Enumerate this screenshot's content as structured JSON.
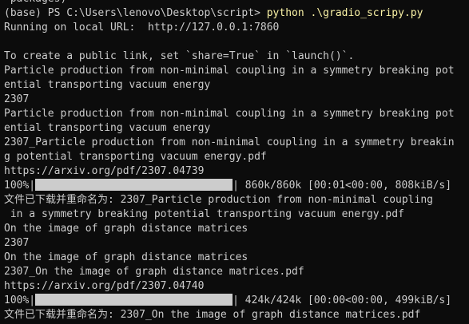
{
  "terminal": {
    "colors": {
      "background": "#0c0c0c",
      "text": "#cccccc",
      "command": "#f9f1a5",
      "progress_fill": "#cccccc"
    },
    "lines": [
      " packages)",
      "(base) PS C:\\Users\\lenovo\\Desktop\\script> ",
      "Running on local URL:  http://127.0.0.1:7860",
      "",
      "To create a public link, set `share=True` in `launch()`.",
      "Particle production from non-minimal coupling in a symmetry breaking pot",
      "ential transporting vacuum energy",
      "2307",
      "Particle production from non-minimal coupling in a symmetry breaking pot",
      "ential transporting vacuum energy",
      "2307_Particle production from non-minimal coupling in a symmetry breakin",
      "g potential transporting vacuum energy.pdf",
      "https://arxiv.org/pdf/2307.04739",
      "",
      "文件已下载并重命名为: 2307_Particle production from non-minimal coupling",
      " in a symmetry breaking potential transporting vacuum energy.pdf",
      "On the image of graph distance matrices",
      "2307",
      "On the image of graph distance matrices",
      "2307_On the image of graph distance matrices.pdf",
      "https://arxiv.org/pdf/2307.04740",
      "",
      "文件已下载并重命名为: 2307_On the image of graph distance matrices.pdf"
    ],
    "command_text": "python .\\gradio_scripy.py",
    "progress": [
      {
        "percent": "100%|",
        "fraction": 1.0,
        "stats": "| 860k/860k [00:01<00:00, 808kiB/s]"
      },
      {
        "percent": "100%|",
        "fraction": 1.0,
        "stats": "| 424k/424k [00:00<00:00, 499kiB/s]"
      }
    ]
  }
}
